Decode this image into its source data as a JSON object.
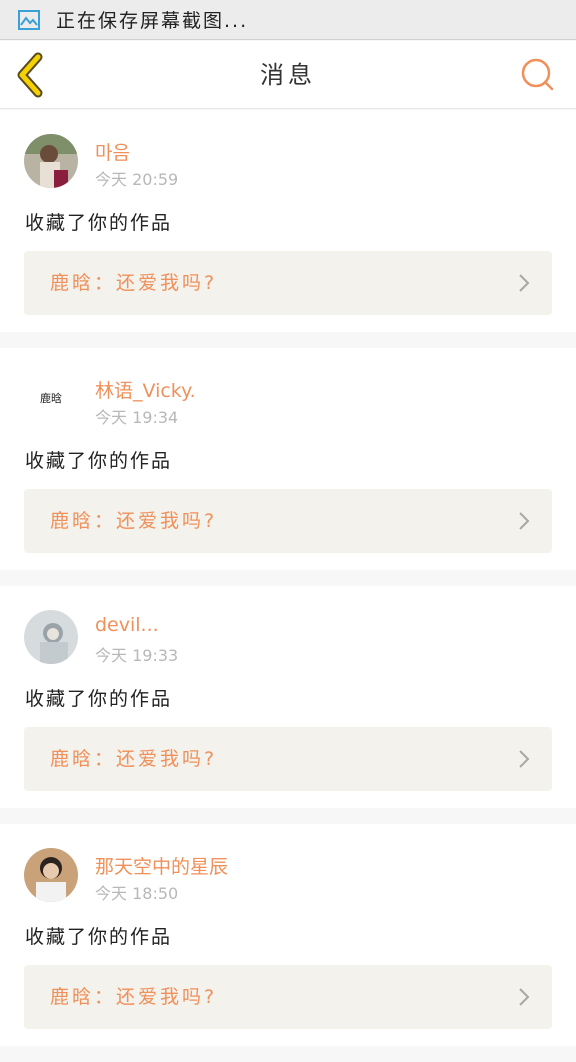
{
  "status_bar": {
    "text": "正在保存屏幕截图..."
  },
  "nav": {
    "title": "消息"
  },
  "colors": {
    "accent": "#f0905a",
    "back_icon": "#f5d200",
    "card_box": "#f3f2ec"
  },
  "messages": [
    {
      "username": "마음",
      "time": "今天 20:59",
      "action": "收藏了你的作品",
      "work_title": "鹿晗：还爱我吗?",
      "avatar_text": ""
    },
    {
      "username": "林语_Vicky.",
      "time": "今天 19:34",
      "action": "收藏了你的作品",
      "work_title": "鹿晗：还爱我吗?",
      "avatar_text": "鹿晗"
    },
    {
      "username": "devil...",
      "time": "今天 19:33",
      "action": "收藏了你的作品",
      "work_title": "鹿晗：还爱我吗?",
      "avatar_text": ""
    },
    {
      "username": "那天空中的星辰",
      "time": "今天 18:50",
      "action": "收藏了你的作品",
      "work_title": "鹿晗：还爱我吗?",
      "avatar_text": ""
    }
  ]
}
